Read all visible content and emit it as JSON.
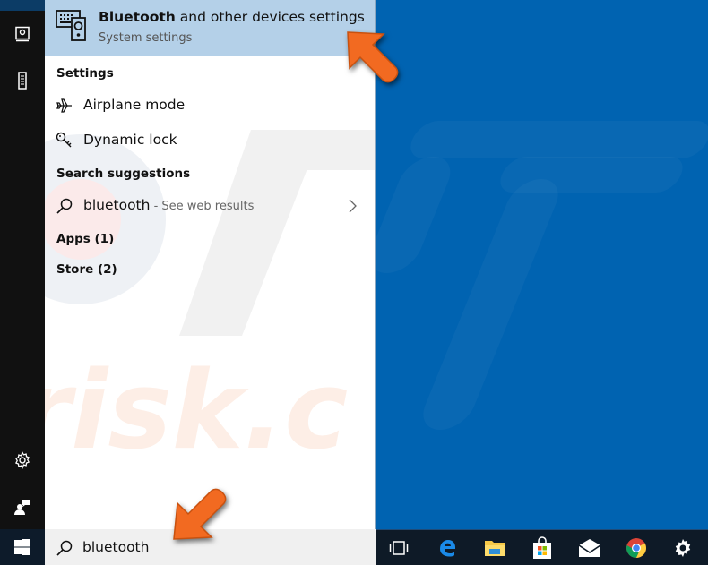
{
  "best_match": {
    "title_bold": "Bluetooth",
    "title_rest": " and other devices settings",
    "subtitle": "System settings",
    "icon": "devices-icon"
  },
  "sections": {
    "settings": {
      "heading": "Settings",
      "items": [
        {
          "label": "Airplane mode",
          "icon": "airplane-icon"
        },
        {
          "label": "Dynamic lock",
          "icon": "key-icon"
        }
      ]
    },
    "search_suggestions": {
      "heading": "Search suggestions",
      "items": [
        {
          "label": "bluetooth",
          "hint": " - See web results",
          "icon": "search-icon"
        }
      ]
    },
    "apps": {
      "heading": "Apps (1)"
    },
    "store": {
      "heading": "Store (2)"
    }
  },
  "left_rail": {
    "icons": [
      "documents-icon",
      "device-icon",
      "settings-gear-icon",
      "feedback-icon"
    ]
  },
  "search": {
    "value": "bluetooth",
    "icon": "search-icon"
  },
  "taskbar": {
    "start_icon": "windows-logo-icon",
    "items": [
      {
        "name": "task-view",
        "icon": "task-view-icon"
      },
      {
        "name": "edge",
        "icon": "edge-icon"
      },
      {
        "name": "file-explorer",
        "icon": "folder-icon"
      },
      {
        "name": "store",
        "icon": "store-bag-icon"
      },
      {
        "name": "mail",
        "icon": "mail-icon"
      },
      {
        "name": "chrome",
        "icon": "chrome-icon"
      },
      {
        "name": "settings",
        "icon": "gear-icon"
      }
    ]
  },
  "colors": {
    "desktop_blue": "#0063b1",
    "highlight": "#b4d0e8",
    "rail": "#111111",
    "arrow": "#f26a21"
  }
}
